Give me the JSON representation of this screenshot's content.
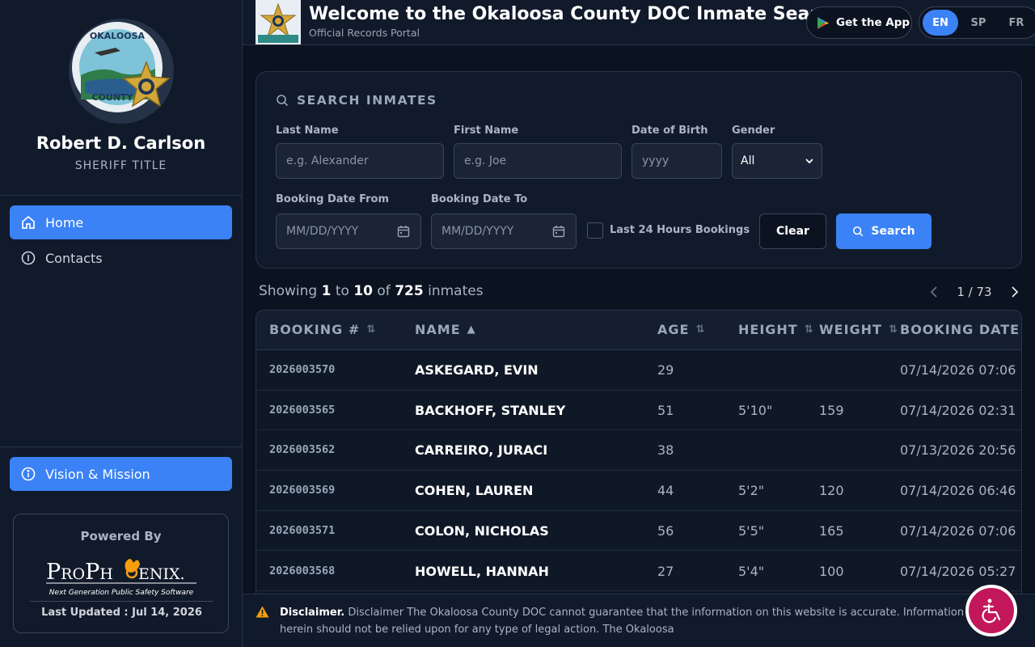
{
  "sidebar": {
    "sheriff_name": "Robert D. Carlson",
    "sheriff_title": "SHERIFF TITLE",
    "nav": [
      {
        "label": "Home",
        "icon": "home-icon"
      },
      {
        "label": "Contacts",
        "icon": "info-icon"
      }
    ],
    "vision_label": "Vision & Mission",
    "powered_by": "Powered By",
    "powered_brand": "ProPhoenix",
    "powered_tagline": "Next Generation Public Safety Software",
    "last_updated": "Last Updated : Jul 14, 2026",
    "county_seal_text": "OKALOOSA COUNTY"
  },
  "header": {
    "title": "Welcome to the Okaloosa County DOC Inmate Search",
    "subtitle": "Official Records Portal",
    "app_button": "Get the App",
    "languages": [
      "EN",
      "SP",
      "FR"
    ],
    "active_language": "EN"
  },
  "search": {
    "title": "SEARCH INMATES",
    "last_name_label": "Last Name",
    "last_name_placeholder": "e.g. Alexander",
    "first_name_label": "First Name",
    "first_name_placeholder": "e.g. Joe",
    "dob_label": "Date of Birth",
    "dob_placeholder": "yyyy",
    "gender_label": "Gender",
    "gender_value": "All",
    "booking_from_label": "Booking Date From",
    "booking_from_placeholder": "MM/DD/YYYY",
    "booking_to_label": "Booking Date To",
    "booking_to_placeholder": "MM/DD/YYYY",
    "last24_label": "Last 24 Hours Bookings",
    "clear_label": "Clear",
    "search_label": "Search"
  },
  "results": {
    "showing_prefix": "Showing",
    "from": "1",
    "to_word": "to",
    "to": "10",
    "of_word": "of",
    "total": "725",
    "suffix": "inmates",
    "page_indicator": "1 / 73"
  },
  "table": {
    "columns": [
      "BOOKING #",
      "NAME",
      "AGE",
      "HEIGHT",
      "WEIGHT",
      "BOOKING DATE"
    ],
    "rows": [
      {
        "booking": "2026003570",
        "name": "ASKEGARD, EVIN",
        "age": "29",
        "height": "",
        "weight": "",
        "date": "07/14/2026 07:06"
      },
      {
        "booking": "2026003565",
        "name": "BACKHOFF, STANLEY",
        "age": "51",
        "height": "5'10\"",
        "weight": "159",
        "date": "07/14/2026 02:31"
      },
      {
        "booking": "2026003562",
        "name": "CARREIRO, JURACI",
        "age": "38",
        "height": "",
        "weight": "",
        "date": "07/13/2026 20:56"
      },
      {
        "booking": "2026003569",
        "name": "COHEN, LAUREN",
        "age": "44",
        "height": "5'2\"",
        "weight": "120",
        "date": "07/14/2026 06:46"
      },
      {
        "booking": "2026003571",
        "name": "COLON, NICHOLAS",
        "age": "56",
        "height": "5'5\"",
        "weight": "165",
        "date": "07/14/2026 07:06"
      },
      {
        "booking": "2026003568",
        "name": "HOWELL, HANNAH",
        "age": "27",
        "height": "5'4\"",
        "weight": "100",
        "date": "07/14/2026 05:27"
      }
    ]
  },
  "disclaimer": {
    "heading": "Disclaimer.",
    "text": "Disclaimer The Okaloosa County DOC cannot guarantee that the information on this website is accurate. Information herein should not be relied upon for any type of legal action. The Okaloosa"
  },
  "colors": {
    "accent": "#3b82f6",
    "background": "#0b1220",
    "panel": "#111a2b",
    "a11y_button": "#c2185b"
  }
}
